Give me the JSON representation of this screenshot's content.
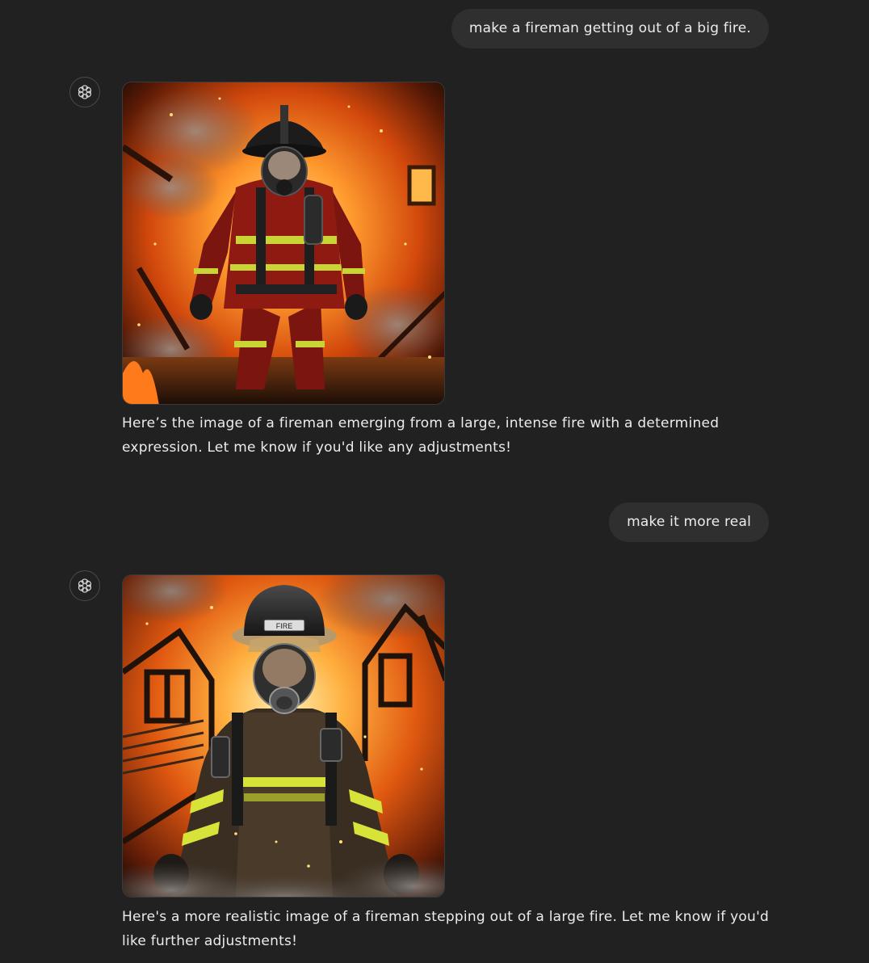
{
  "conversation": {
    "messages": [
      {
        "role": "user",
        "text": "make a fireman getting out of a big fire."
      },
      {
        "role": "assistant",
        "avatar_icon": "openai-logo-icon",
        "image_description_icon": "fireman-emerging-fire-image",
        "text": "Here’s the image of a fireman emerging from a large, intense fire with a determined expression. Let me know if you'd like any adjustments!"
      },
      {
        "role": "user",
        "text": "make it more real"
      },
      {
        "role": "assistant",
        "avatar_icon": "openai-logo-icon",
        "image_description_icon": "realistic-fireman-fire-image",
        "text": "Here's a more realistic image of a fireman stepping out of a large fire. Let me know if you'd like further adjustments!"
      }
    ]
  },
  "colors": {
    "background": "#212121",
    "user_bubble": "#2f2f2f",
    "text": "#ececec"
  }
}
